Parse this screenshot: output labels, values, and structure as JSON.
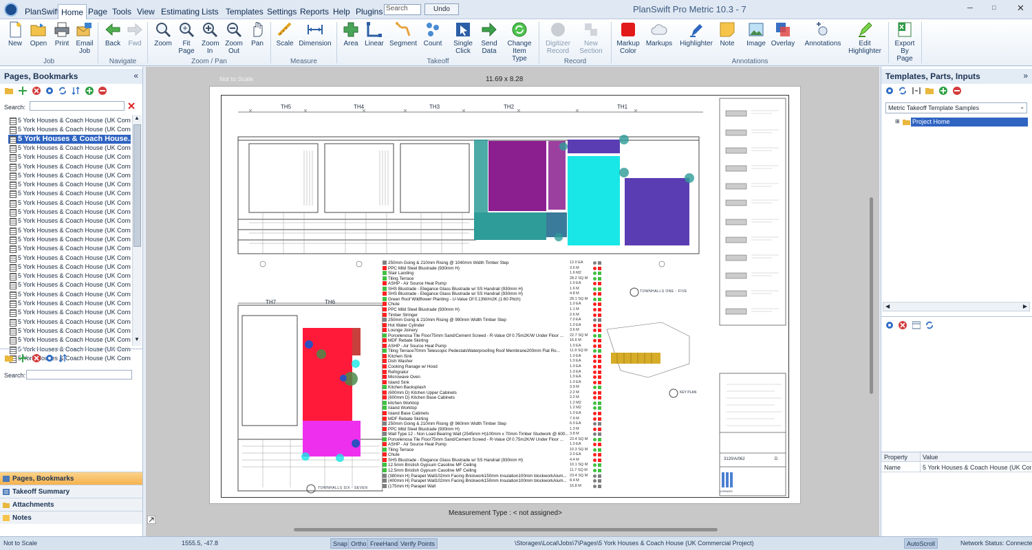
{
  "app": {
    "name": "PlanSwift",
    "title": "PlanSwift Pro Metric 10.3 - 7",
    "search_placeholder": "Search",
    "undo_label": "Undo"
  },
  "menu_tabs": [
    "Home",
    "Page",
    "Tools",
    "View",
    "Estimating",
    "Lists",
    "Templates",
    "Settings",
    "Reports",
    "Help",
    "Plugins"
  ],
  "ribbon": {
    "buttons": [
      {
        "label": "New",
        "icon": "new-document-icon"
      },
      {
        "label": "Open",
        "icon": "open-folder-icon"
      },
      {
        "label": "Print",
        "icon": "printer-icon"
      },
      {
        "label": "Email Job",
        "icon": "email-icon"
      },
      {
        "label": "Back",
        "icon": "arrow-left-icon"
      },
      {
        "label": "Fwd",
        "icon": "arrow-right-icon"
      },
      {
        "label": "Zoom",
        "icon": "magnifier-icon"
      },
      {
        "label": "Fit Page",
        "icon": "zoom-fit-icon"
      },
      {
        "label": "Zoom In",
        "icon": "zoom-in-icon"
      },
      {
        "label": "Zoom Out",
        "icon": "zoom-out-icon"
      },
      {
        "label": "Pan",
        "icon": "hand-icon"
      },
      {
        "label": "Scale",
        "icon": "scale-icon"
      },
      {
        "label": "Dimension",
        "icon": "dimension-icon"
      },
      {
        "label": "Area",
        "icon": "area-icon"
      },
      {
        "label": "Linear",
        "icon": "linear-icon"
      },
      {
        "label": "Segment",
        "icon": "segment-icon"
      },
      {
        "label": "Count",
        "icon": "count-icon"
      },
      {
        "label": "Single Click",
        "icon": "single-click-icon"
      },
      {
        "label": "Send Data",
        "icon": "send-data-icon"
      },
      {
        "label": "Change Item Type",
        "icon": "change-type-icon"
      },
      {
        "label": "Digitizer Record",
        "icon": "digitizer-icon"
      },
      {
        "label": "New Section",
        "icon": "new-section-icon"
      },
      {
        "label": "Markup Color",
        "icon": "markup-color-icon"
      },
      {
        "label": "Markups",
        "icon": "cloud-icon"
      },
      {
        "label": "Highlighter",
        "icon": "highlighter-icon"
      },
      {
        "label": "Note",
        "icon": "note-icon"
      },
      {
        "label": "Image",
        "icon": "image-icon"
      },
      {
        "label": "Overlay",
        "icon": "overlay-icon"
      },
      {
        "label": "Annotations",
        "icon": "annotations-icon"
      },
      {
        "label": "Edit Highlighter",
        "icon": "edit-highlighter-icon"
      },
      {
        "label": "Export By Page",
        "icon": "excel-icon"
      }
    ],
    "groups": [
      "Job",
      "Navigate",
      "Zoom / Pan",
      "Measure",
      "Takeoff",
      "Record",
      "Annotations"
    ]
  },
  "left_panel": {
    "title": "Pages, Bookmarks",
    "search_label": "Search:",
    "pages": [
      "5 York Houses & Coach House (UK Comm...",
      "5 York Houses & Coach House (UK Comm...",
      "5 York Houses & Coach House...",
      "5 York Houses & Coach House (UK Comm...",
      "5 York Houses & Coach House (UK Comm...",
      "5 York Houses & Coach House (UK Comm...",
      "5 York Houses & Coach House (UK Comm...",
      "5 York Houses & Coach House (UK Comm...",
      "5 York Houses & Coach House (UK Comm...",
      "5 York Houses & Coach House (UK Comm...",
      "5 York Houses & Coach House (UK Comm...",
      "5 York Houses & Coach House (UK Comm...",
      "5 York Houses & Coach House (UK Comm...",
      "5 York Houses & Coach House (UK Comm...",
      "5 York Houses & Coach House (UK Comm...",
      "5 York Houses & Coach House (UK Comm...",
      "5 York Houses & Coach House (UK Comm...",
      "5 York Houses & Coach House (UK Comm...",
      "5 York Houses & Coach House (UK Comm...",
      "5 York Houses & Coach House (UK Comm...",
      "5 York Houses & Coach House (UK Comm...",
      "5 York Houses & Coach House (UK Comm...",
      "5 York Houses & Coach House (UK Comm...",
      "5 York Houses & Coach House (UK Comm...",
      "5 York Houses & Coach House (UK Comm...",
      "5 York Houses & Coach House (UK Comm...",
      "5 York Houses & Coach House (UK Comm..."
    ],
    "selected_index": 2,
    "bookmark_search_label": "Search:",
    "nav_tabs": [
      "Pages, Bookmarks",
      "Takeoff Summary",
      "Attachments",
      "Notes"
    ]
  },
  "canvas": {
    "scale_note": "Not to Scale",
    "sheet_size": "11.69 x 8.28",
    "measurement_type": "Measurement Type : < not assigned>",
    "unit_labels": [
      "TH5",
      "TH4",
      "TH3",
      "TH2",
      "TH1",
      "TH7",
      "TH6"
    ],
    "block_labels": [
      "TOWNHALLS ONE - FIVE",
      "TOWNHALLS SIX - SEVEN",
      "KEY PLAN"
    ],
    "drawing_number": "3120/A/062",
    "revision": "D",
    "firm_name": "VOPAKES",
    "takeoff_items": [
      {
        "text": "250mm Going & 210mm Rising @ 1040mm Width Timber Step",
        "qty": "12.0 EA",
        "color": "#7f7f7f"
      },
      {
        "text": "PPC Mild Steel Blustrade (930mm H)",
        "qty": "3.6 M",
        "color": "#ff2020"
      },
      {
        "text": "Stair Landing",
        "qty": "1.6 M2",
        "color": "#40c040"
      },
      {
        "text": "Tiling Terrace",
        "qty": "28.2 SQ M",
        "color": "#40c040"
      },
      {
        "text": "ASHP - Air Source Heat Pump",
        "qty": "1.0 EA",
        "color": "#ff2020"
      },
      {
        "text": "SHS Blustrade - Elegance Glass Blustrade w/ SS Handrail (930mm H)",
        "qty": "1.6 M",
        "color": "#40c040"
      },
      {
        "text": "SHS Blustrade - Elegance Glass Blustrade w/ SS Handrail (930mm H)",
        "qty": "4.8 M",
        "color": "#ff2020"
      },
      {
        "text": "Green Roof Wildflower Planting - U-Value Of 0.13W/m2K (1:60 Pitch)",
        "qty": "28.1 SQ M",
        "color": "#40c040"
      },
      {
        "text": "Chute",
        "qty": "1.0 EA",
        "color": "#ff2020"
      },
      {
        "text": "PPC Mild Steel Blustrade (930mm H)",
        "qty": "1.1 M",
        "color": "#ff2020"
      },
      {
        "text": "Timber Stringer",
        "qty": "2.6 M",
        "color": "#ff2020"
      },
      {
        "text": "250mm Going & 210mm Rising @ 990mm Width Timber Step",
        "qty": "7.0 EA",
        "color": "#7f7f7f"
      },
      {
        "text": "Hot Water Cylinder",
        "qty": "1.0 EA",
        "color": "#ff2020"
      },
      {
        "text": "Lounge Joinery",
        "qty": "3.6 M",
        "color": "#ff2020"
      },
      {
        "text": "Porcelenosa Tile Floor75mm Sand/Cement Screed - R-Value Of 0.75m2K/W Under Floor ...",
        "qty": "22.7 SQ M",
        "color": "#40c040"
      },
      {
        "text": "MDF Rebate Skirting",
        "qty": "16.6 M",
        "color": "#ff2020"
      },
      {
        "text": "ASHP - Air Source Heat Pump",
        "qty": "1.0 EA",
        "color": "#ff2020"
      },
      {
        "text": "Tiling Terrace70mm Telescopic PedestalsWaterproofing Roof Membrane200mm Flat Ro...",
        "qty": "11.9 SQ M",
        "color": "#40c040"
      },
      {
        "text": "Kitchen Sink",
        "qty": "1.0 EA",
        "color": "#ff2020"
      },
      {
        "text": "Dish Washer",
        "qty": "1.0 EA",
        "color": "#ff2020"
      },
      {
        "text": "Cooking Ranage w/ Hood",
        "qty": "1.0 EA",
        "color": "#ff2020"
      },
      {
        "text": "Refrigrator",
        "qty": "1.0 EA",
        "color": "#ff2020"
      },
      {
        "text": "Microwave Oven",
        "qty": "1.0 EA",
        "color": "#ff2020"
      },
      {
        "text": "Island Sink",
        "qty": "1.0 EA",
        "color": "#ff2020"
      },
      {
        "text": "Kitchen Backsplash",
        "qty": "3.9 M",
        "color": "#40c040"
      },
      {
        "text": "(600mm D) Kitchen Upper Cabinets",
        "qty": "2.2 M",
        "color": "#ff2020"
      },
      {
        "text": "(600mm D) Kitchen Base Cabinets",
        "qty": "2.2 M",
        "color": "#ff2020"
      },
      {
        "text": "kitchen Worktop",
        "qty": "1.2 M2",
        "color": "#40c040"
      },
      {
        "text": "Island Worktop",
        "qty": "1.2 M2",
        "color": "#40c040"
      },
      {
        "text": "Island Base Cabinets",
        "qty": "1.0 EA",
        "color": "#ff2020"
      },
      {
        "text": "MDF Rebate Skirting",
        "qty": "7.9 M",
        "color": "#ff2020"
      },
      {
        "text": "250mm Going & 210mm Rising @ 960mm Width Timber Step",
        "qty": "6.0 EA",
        "color": "#7f7f7f"
      },
      {
        "text": "PPC Mild Steel Blustrade (930mm H)",
        "qty": "1.3 M",
        "color": "#ff2020"
      },
      {
        "text": "Wall Type 12 - Non Load Bearing Wall (2545mm H)100mm x 70mm Timber Studwork @ 600...",
        "qty": "3.8 M",
        "color": "#7f7f7f"
      },
      {
        "text": "Porcelenosa Tile Floor75mm Sand/Cement Screed - R-Value Of 0.75m2K/W Under Floor ...",
        "qty": "23.4 SQ M",
        "color": "#40c040"
      },
      {
        "text": "ASHP - Air Source Heat Pump",
        "qty": "1.0 EA",
        "color": "#ff2020"
      },
      {
        "text": "Tiling Terrace",
        "qty": "10.3 SQ M",
        "color": "#40c040"
      },
      {
        "text": "Chute",
        "qty": "2.0 EA",
        "color": "#ff2020"
      },
      {
        "text": "SHS Blustrade - Elegance Glass Blustrade w/ SS Handrail (930mm H)",
        "qty": "4.4 M",
        "color": "#ff2020"
      },
      {
        "text": "12.5mm Bristish Gypsum Casoline MF Ceiling",
        "qty": "10.1 SQ M",
        "color": "#40c040"
      },
      {
        "text": "12.5mm Bristish Gypsum Casoline MF Ceiling",
        "qty": "11.7 SQ M",
        "color": "#40c040"
      },
      {
        "text": "(380mm H) Parapet Wall102mm Facing Brickwork150mm Insulation100mm blockworkAlum...",
        "qty": "23.4 SQ M",
        "color": "#7f7f7f"
      },
      {
        "text": "(400mm H) Parapet Wall102mm Facing Brickwork150mm Insulation100mm blockworkAlum...",
        "qty": "8.4 M",
        "color": "#7f7f7f"
      },
      {
        "text": "(175mm H) Parapet Wall",
        "qty": "16.8 M",
        "color": "#7f7f7f"
      }
    ]
  },
  "right_panel": {
    "title": "Templates, Parts, Inputs",
    "template_select": "Metric Takeoff Template Samples",
    "tree_root": "Project Home",
    "property_header": "Property",
    "value_header": "Value",
    "properties": [
      {
        "name": "Name",
        "value": "5 York Houses & Coach House (UK Commer"
      }
    ]
  },
  "statusbar": {
    "scale": "Not to Scale",
    "coords": "1555.5, -47.8",
    "toggles": [
      "Snap",
      "Ortho",
      "FreeHand",
      "Verify Points"
    ],
    "path": "\\Storages\\Local\\Jobs\\7\\Pages\\5 York Houses & Coach House (UK Commercial Project)",
    "autoscroll": "AutoScroll",
    "network": "Network Status: Connected"
  },
  "colors": {
    "accent": "#2f64c2",
    "area_magenta": "#8b1f8f",
    "area_cyan": "#19e6e6",
    "area_purple": "#5a3db3",
    "area_teal": "#2e9c98",
    "area_red": "#ff1a3a",
    "area_pink": "#ee30ee",
    "area_yellow": "#d6ac28"
  }
}
